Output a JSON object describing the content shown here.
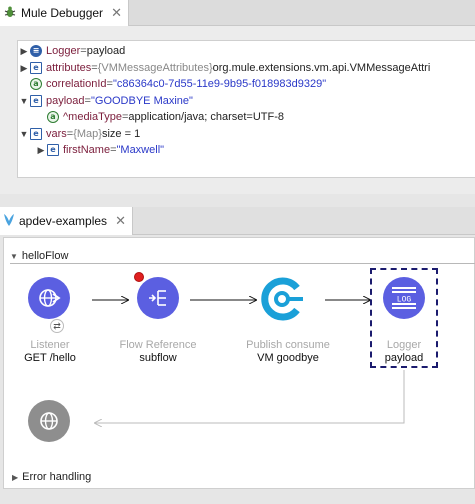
{
  "debugger": {
    "tab_title": "Mule Debugger",
    "close_glyph": "✕",
    "rows": [
      {
        "icon": "list",
        "key": "Logger",
        "eq": " = ",
        "type": "",
        "value": "payload",
        "value_style": "v"
      },
      {
        "icon": "e",
        "key": "attributes",
        "eq": " = ",
        "type": "{VMMessageAttributes} ",
        "value": "org.mule.extensions.vm.api.VMMessageAttri",
        "value_style": "v"
      },
      {
        "icon": "a",
        "key": "correlationId",
        "eq": " = ",
        "type": "",
        "value": "\"c86364c0-7d55-11e9-9b95-f018983d9329\"",
        "value_style": "s"
      },
      {
        "icon": "e",
        "key": "payload",
        "eq": " = ",
        "type": "",
        "value": "\"GOODBYE Maxine\"",
        "value_style": "s"
      },
      {
        "icon": "a",
        "key": "^mediaType",
        "eq": " = ",
        "type": "",
        "value": "application/java; charset=UTF-8",
        "value_style": "v"
      },
      {
        "icon": "e",
        "key": "vars",
        "eq": " = ",
        "type": "{Map} ",
        "value": "size = 1",
        "value_style": "v"
      },
      {
        "icon": "e",
        "key": "firstName",
        "eq": " = ",
        "type": "",
        "value": "\"Maxwell\"",
        "value_style": "s"
      }
    ]
  },
  "editor": {
    "tab_title": "apdev-examples",
    "close_glyph": "✕",
    "flow_name": "helloFlow",
    "error_handling": "Error handling",
    "components": {
      "listener": {
        "title": "Listener",
        "subtitle": "GET /hello"
      },
      "flow_reference": {
        "title": "Flow Reference",
        "subtitle": "subflow"
      },
      "publish_consume": {
        "title": "Publish consume",
        "subtitle": "VM goodbye"
      },
      "logger": {
        "title": "Logger",
        "subtitle": "payload",
        "icon_text": "LOG"
      }
    }
  },
  "colors": {
    "component_purple": "#5b5fe1",
    "vm_blue": "#1aa0d8",
    "breakpoint_red": "#e02020",
    "selection_navy": "#1b1b6e"
  }
}
